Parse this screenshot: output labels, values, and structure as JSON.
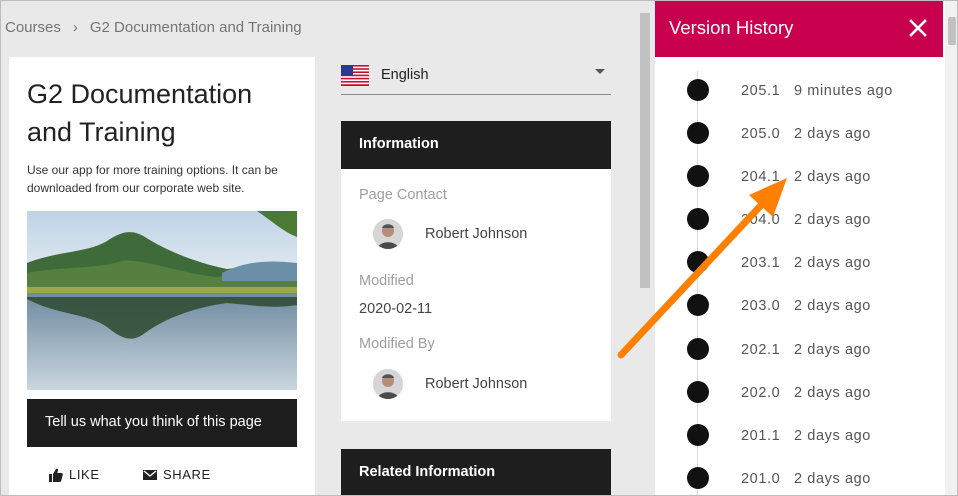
{
  "breadcrumb": {
    "items": [
      "Courses",
      "G2 Documentation and Training"
    ],
    "separator": "›"
  },
  "card": {
    "title": "G2 Documentation and Training",
    "description": "Use our app for more training options. It can be downloaded from our corporate web site.",
    "feedback_label": "Tell us what you think of this page",
    "like_label": "LIKE",
    "share_label": "SHARE"
  },
  "language": {
    "selected": "English"
  },
  "info": {
    "header": "Information",
    "page_contact_label": "Page Contact",
    "page_contact_name": "Robert Johnson",
    "modified_label": "Modified",
    "modified_value": "2020-02-11",
    "modified_by_label": "Modified By",
    "modified_by_name": "Robert Johnson"
  },
  "related": {
    "header": "Related Information"
  },
  "version_history": {
    "title": "Version History",
    "items": [
      {
        "version": "205.1",
        "time": "9 minutes ago"
      },
      {
        "version": "205.0",
        "time": "2 days ago"
      },
      {
        "version": "204.1",
        "time": "2 days ago"
      },
      {
        "version": "204.0",
        "time": "2 days ago"
      },
      {
        "version": "203.1",
        "time": "2 days ago"
      },
      {
        "version": "203.0",
        "time": "2 days ago"
      },
      {
        "version": "202.1",
        "time": "2 days ago"
      },
      {
        "version": "202.0",
        "time": "2 days ago"
      },
      {
        "version": "201.1",
        "time": "2 days ago"
      },
      {
        "version": "201.0",
        "time": "2 days ago"
      }
    ]
  },
  "colors": {
    "accent": "#c8004e",
    "panel_dark": "#1e1e1e",
    "annotation_arrow": "#ff8000"
  },
  "icons": [
    "chevron-right-icon",
    "us-flag-icon",
    "caret-down-icon",
    "thumbs-up-icon",
    "mail-icon",
    "close-icon",
    "timeline-dot-icon"
  ]
}
